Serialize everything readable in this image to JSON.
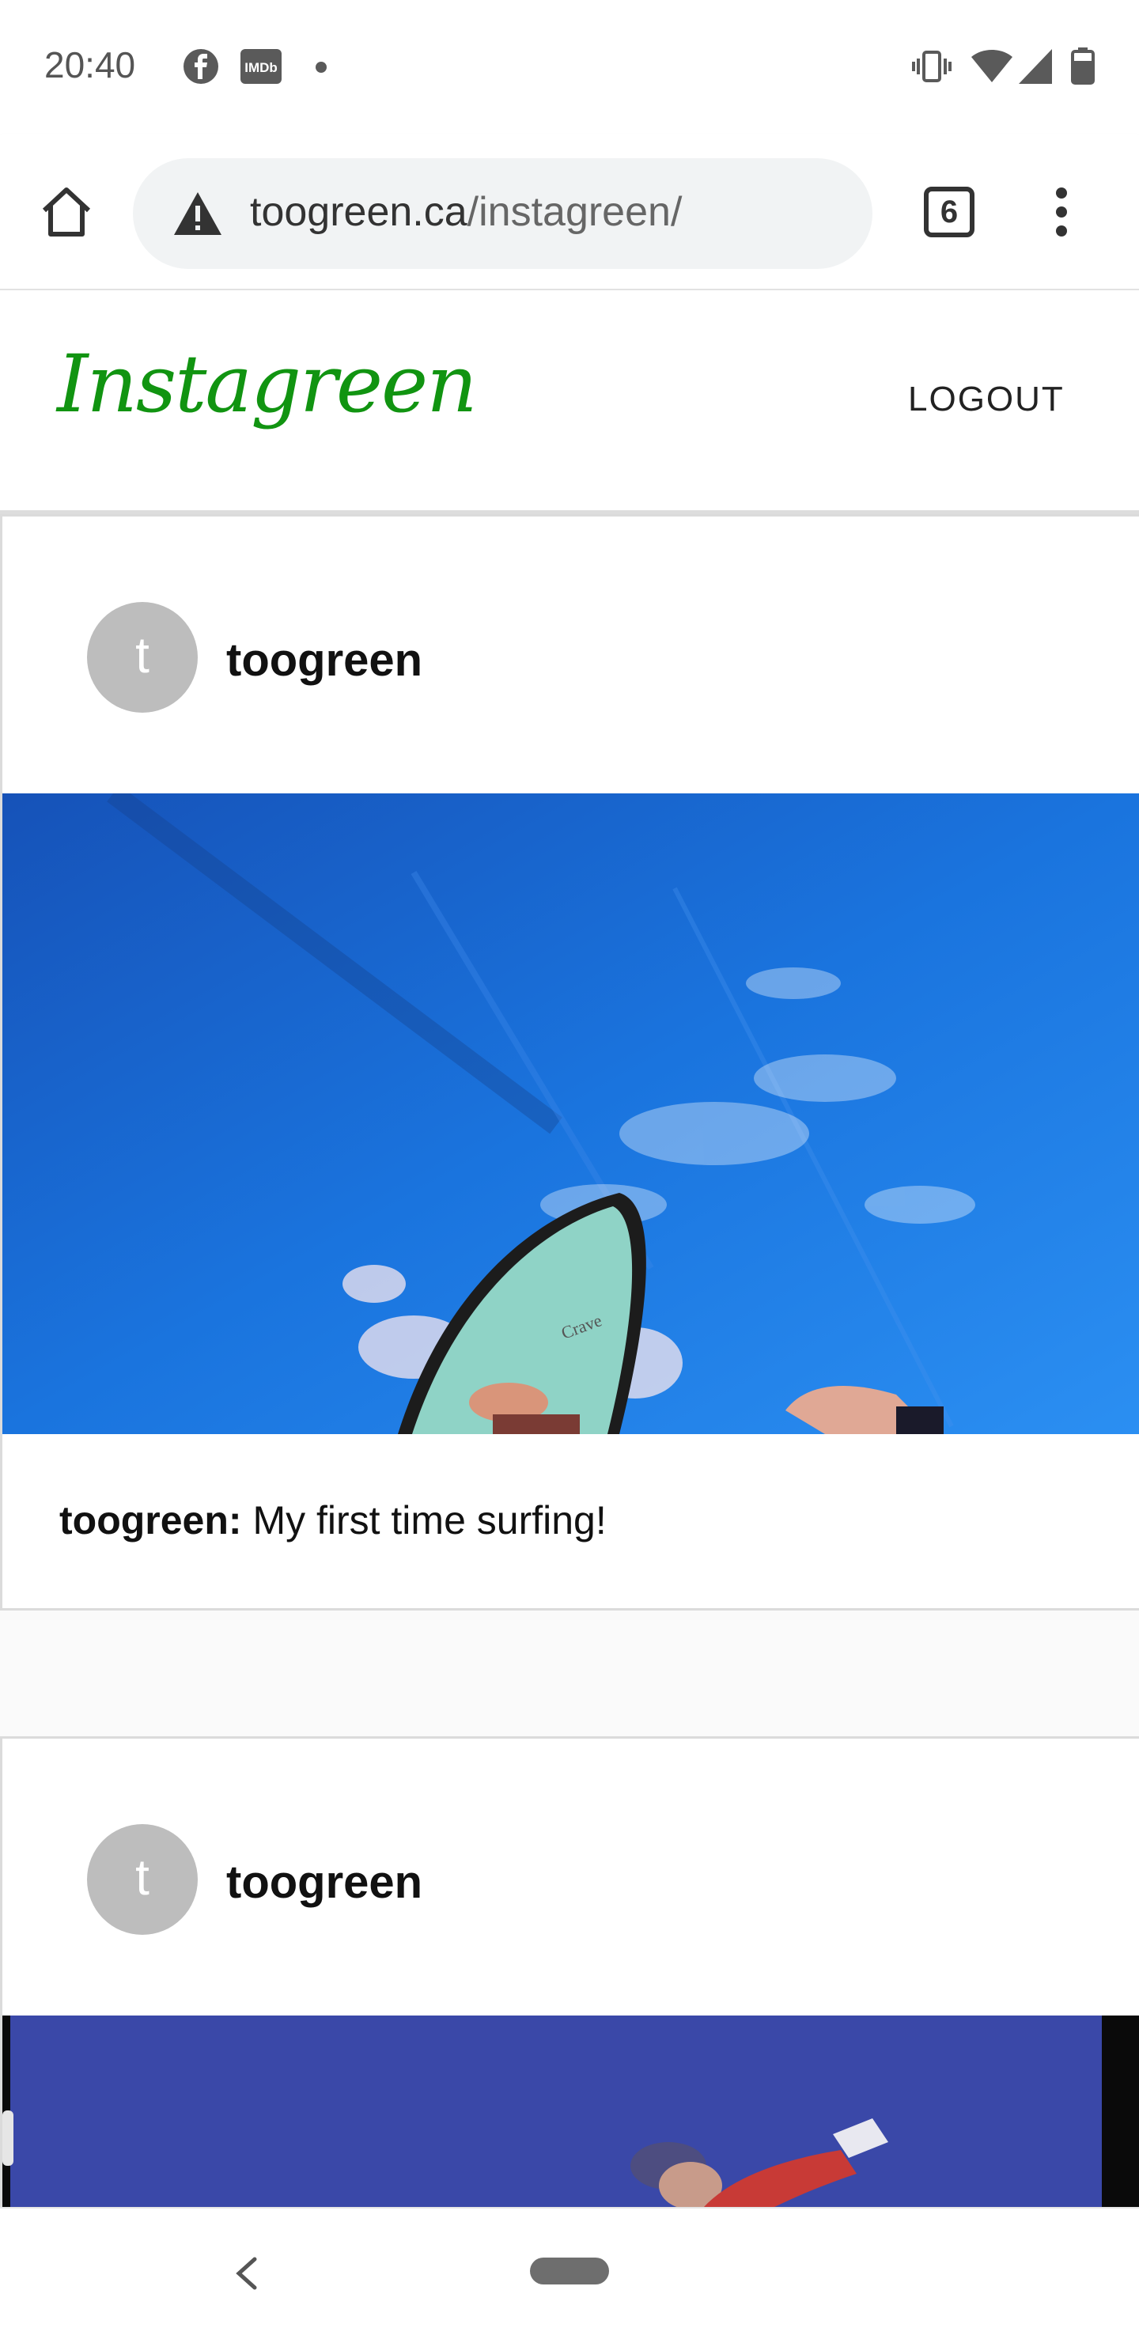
{
  "status_bar": {
    "time": "20:40",
    "left_icons": [
      "facebook-icon",
      "imdb-icon",
      "dot-icon"
    ],
    "imdb_label": "IMDb",
    "right_icons": [
      "vibrate-icon",
      "wifi-icon",
      "signal-icon",
      "battery-icon"
    ]
  },
  "browser": {
    "url_domain": "toogreen.ca",
    "url_path": "/instagreen/",
    "tab_count": "6"
  },
  "header": {
    "logo": "Instagreen",
    "logout_label": "LOGOUT"
  },
  "posts": [
    {
      "avatar_letter": "t",
      "username": "toogreen",
      "caption_user": "toogreen:",
      "caption_text": " My first time surfing!",
      "image_alt": "surfboard on blue wave",
      "board_text": "Crave"
    },
    {
      "avatar_letter": "t",
      "username": "toogreen",
      "image_alt": "person in red jacket against blue sky"
    }
  ],
  "colors": {
    "brand_green": "#119411",
    "avatar_gray": "#bdbdbd",
    "water_blue": "#1e7be6"
  }
}
